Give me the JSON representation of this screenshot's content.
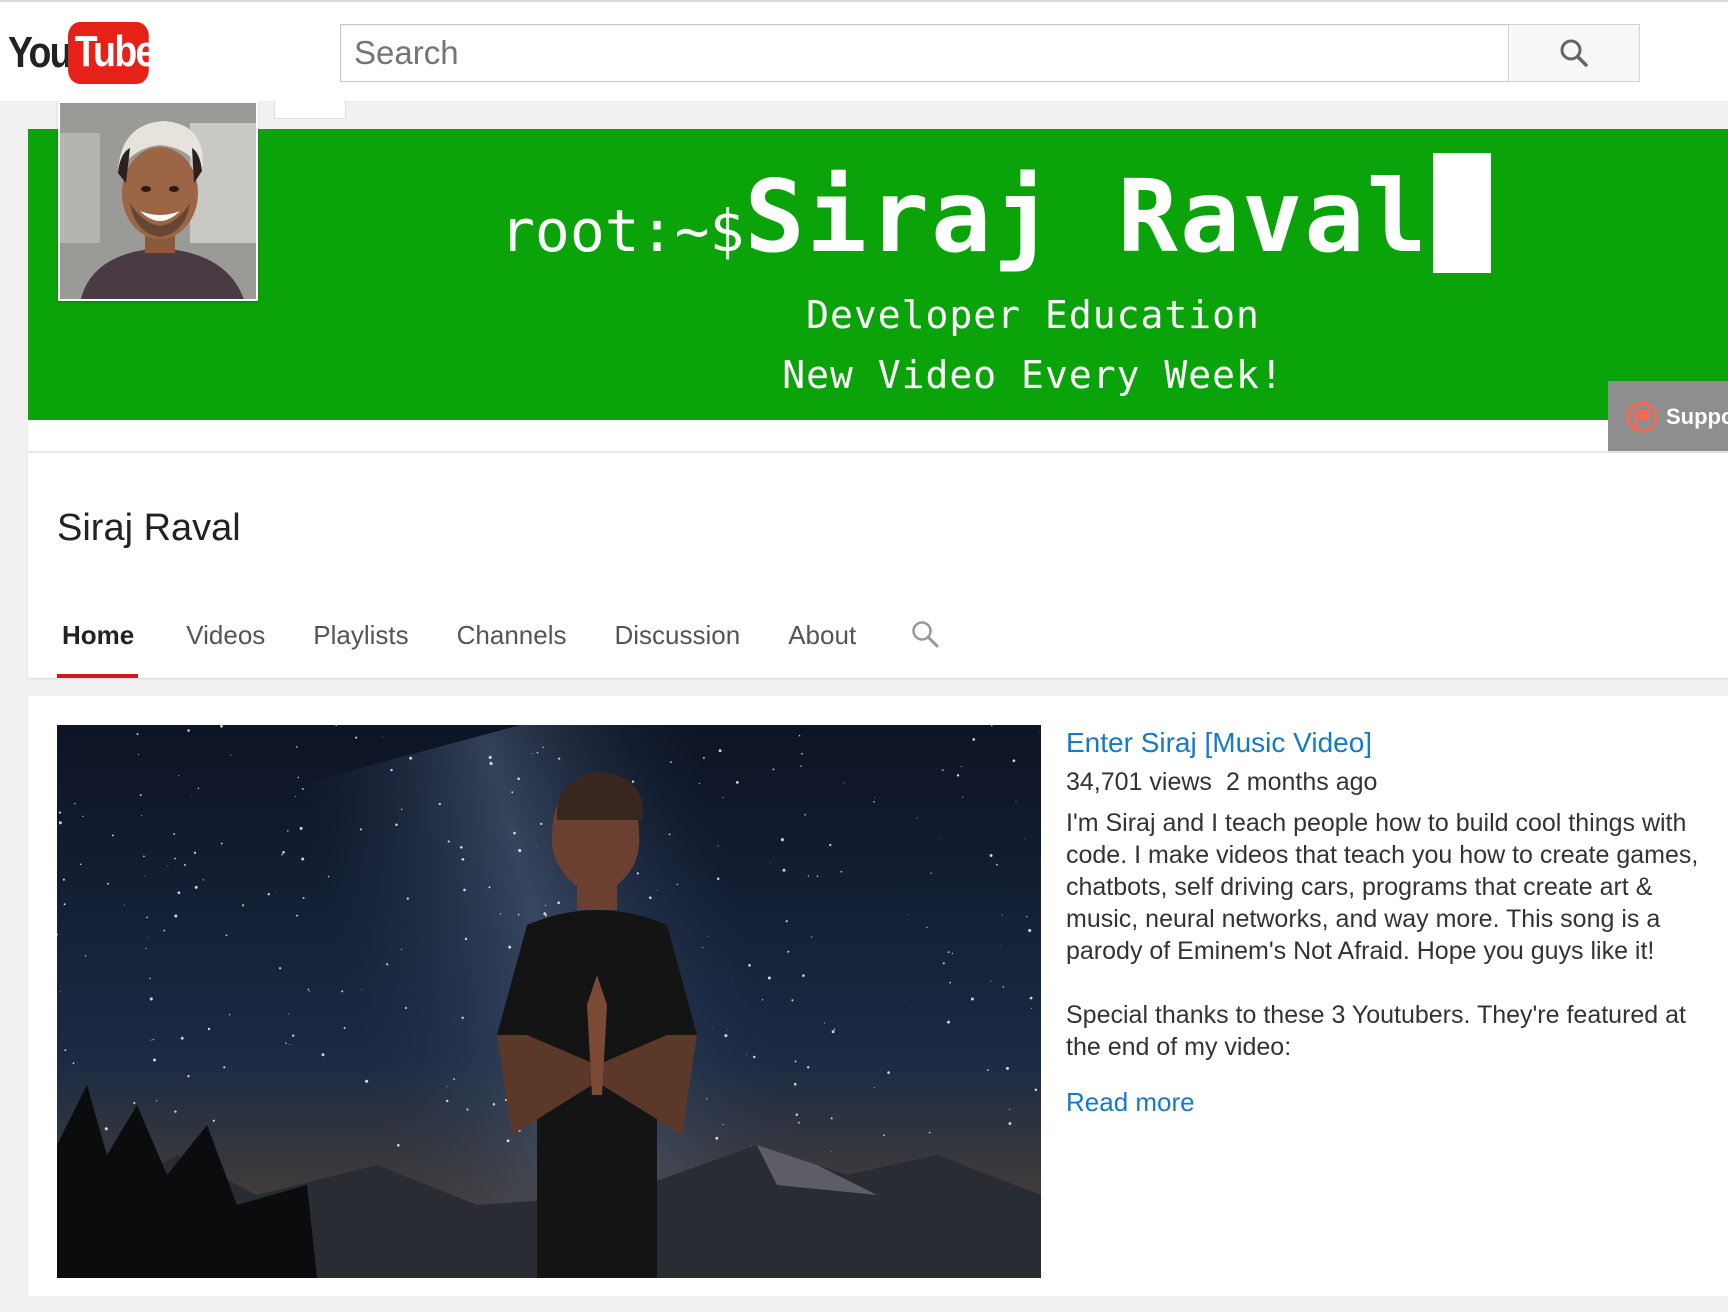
{
  "logo": {
    "you": "You",
    "tube": "Tube"
  },
  "search": {
    "placeholder": "Search"
  },
  "banner": {
    "prompt": "root:~$",
    "name": "Siraj Raval",
    "line2": "Developer Education",
    "line3": "New Video Every Week!",
    "bg_color": "#0aa30a",
    "support_label": "Suppo"
  },
  "channel": {
    "title": "Siraj Raval",
    "tabs": [
      {
        "label": "Home",
        "active": true
      },
      {
        "label": "Videos"
      },
      {
        "label": "Playlists"
      },
      {
        "label": "Channels"
      },
      {
        "label": "Discussion"
      },
      {
        "label": "About"
      }
    ],
    "tab_search_icon": "search-icon"
  },
  "featured": {
    "title": "Enter Siraj [Music Video]",
    "views": "34,701 views",
    "age": "2 months ago",
    "description": "I'm Siraj and I teach people how to build cool things with code. I make videos that teach you how to create games, chatbots, self driving cars, programs that create art & music, neural networks, and way more. This song is a parody of Eminem's Not Afraid. Hope you guys like it!\n\nSpecial thanks to these 3 Youtubers. They're featured at the end of my video:",
    "read_more": "Read more"
  },
  "colors": {
    "accent_red": "#cc181e",
    "link_blue": "#167ac6"
  }
}
